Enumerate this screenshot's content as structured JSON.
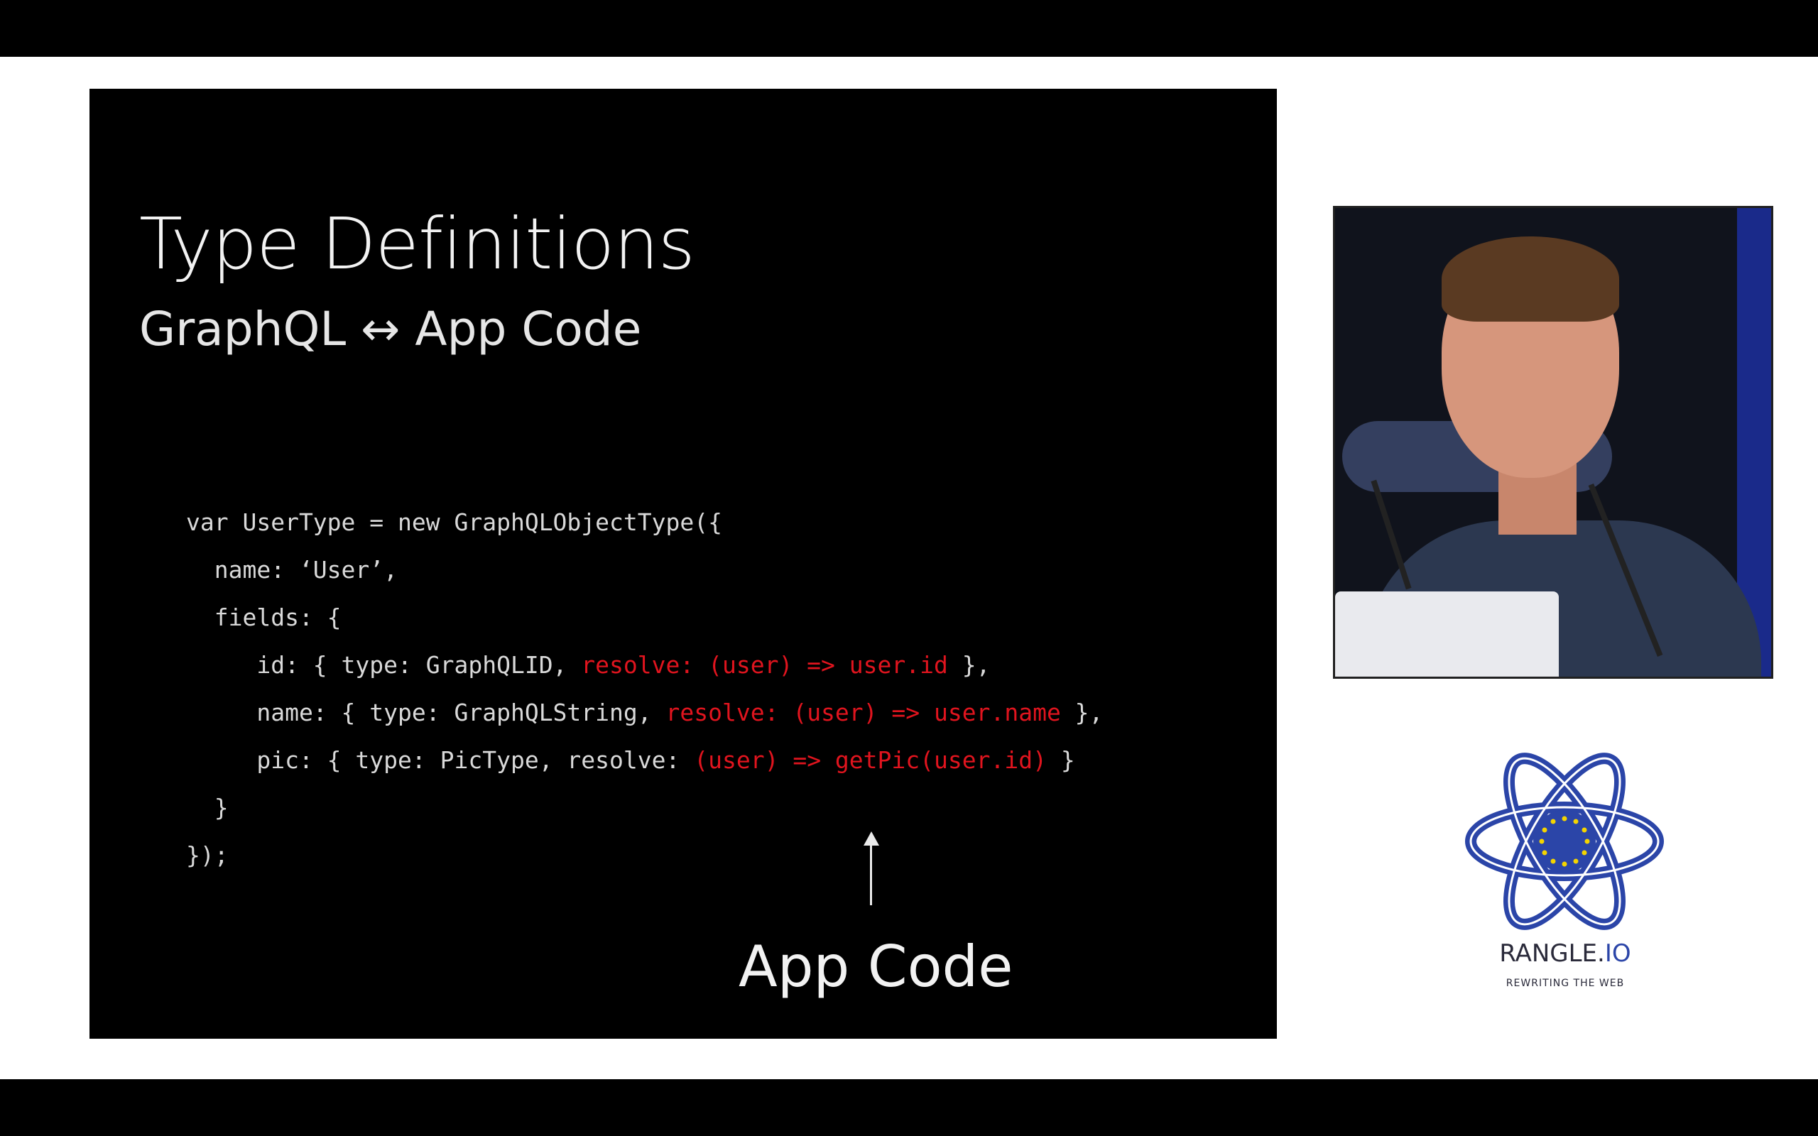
{
  "slide": {
    "title": "Type Definitions",
    "subtitle": "GraphQL ↔ App Code",
    "code_lines": [
      {
        "segments": [
          {
            "text": "var UserType = new GraphQLObjectType({",
            "red": false
          }
        ]
      },
      {
        "segments": [
          {
            "text": "  name: ‘User’,",
            "red": false
          }
        ]
      },
      {
        "segments": [
          {
            "text": "  fields: {",
            "red": false
          }
        ]
      },
      {
        "segments": [
          {
            "text": "     id: { type: GraphQLID, ",
            "red": false
          },
          {
            "text": "resolve: (user) => user.id",
            "red": true
          },
          {
            "text": " },",
            "red": false
          }
        ]
      },
      {
        "segments": [
          {
            "text": "     name: { type: GraphQLString, ",
            "red": false
          },
          {
            "text": "resolve: (user) => user.name",
            "red": true
          },
          {
            "text": " },",
            "red": false
          }
        ]
      },
      {
        "segments": [
          {
            "text": "     pic: { type: PicType, resolve: ",
            "red": false
          },
          {
            "text": "(user) => getPic(user.id)",
            "red": true
          },
          {
            "text": " }",
            "red": false
          }
        ]
      },
      {
        "segments": [
          {
            "text": "  }",
            "red": false
          }
        ]
      },
      {
        "segments": [
          {
            "text": "});",
            "red": false
          }
        ]
      }
    ],
    "annotation_label": "App Code"
  },
  "sponsor": {
    "name_main": "RANGLE.",
    "name_accent": "IO",
    "tagline": "REWRITING THE WEB",
    "logo_icon": "react-atom-eu-stars-icon"
  },
  "video": {
    "content": "speaker-camera-feed"
  },
  "colors": {
    "slide_background": "#000000",
    "code_text": "#d9d9d9",
    "code_highlight": "#e0141e",
    "page_background": "#ffffff",
    "sponsor_blue": "#2b45a8"
  }
}
